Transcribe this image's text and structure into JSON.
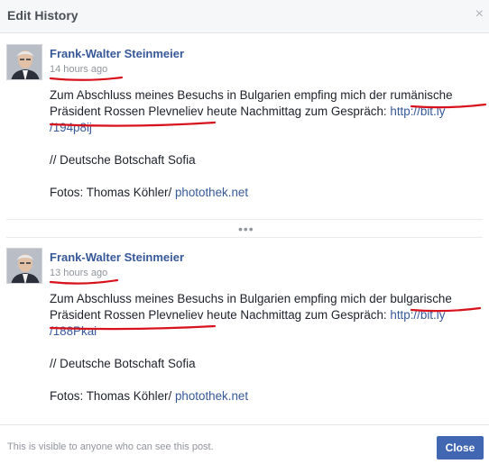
{
  "header": {
    "title": "Edit History",
    "close_glyph": "×"
  },
  "entries": [
    {
      "author": "Frank-Walter Steinmeier",
      "time": "14 hours ago",
      "text_part1": "Zum Abschluss meines Besuchs in Bulgarien empfing mich der ",
      "text_highlight": "rumänische",
      "text_part2": "Präsident Rossen Plevneliev",
      "text_part3": " heute Nachmittag zum Gespräch: ",
      "link1": "http://bit.ly",
      "link2": "/194p8ij",
      "line2": "// Deutsche Botschaft Sofia",
      "line3_prefix": "Fotos: Thomas Köhler/ ",
      "line3_link": "photothek.net"
    },
    {
      "author": "Frank-Walter Steinmeier",
      "time": "13 hours ago",
      "text_part1": "Zum Abschluss meines Besuchs in Bulgarien empfing mich der ",
      "text_highlight": "bulgarische",
      "text_part2": "Präsident Rossen Plevneliev",
      "text_part3": " heute Nachmittag zum Gespräch: ",
      "link1": "http://bit.ly",
      "link2": "/188Pkai",
      "line2": "// Deutsche Botschaft Sofia",
      "line3_prefix": "Fotos: Thomas Köhler/ ",
      "line3_link": "photothek.net"
    }
  ],
  "more_glyph": "•••",
  "footer": {
    "note": "This is visible to anyone who can see this post.",
    "close_label": "Close"
  },
  "colors": {
    "annotation": "#d8121c",
    "link": "#365899",
    "button": "#4267b2"
  }
}
